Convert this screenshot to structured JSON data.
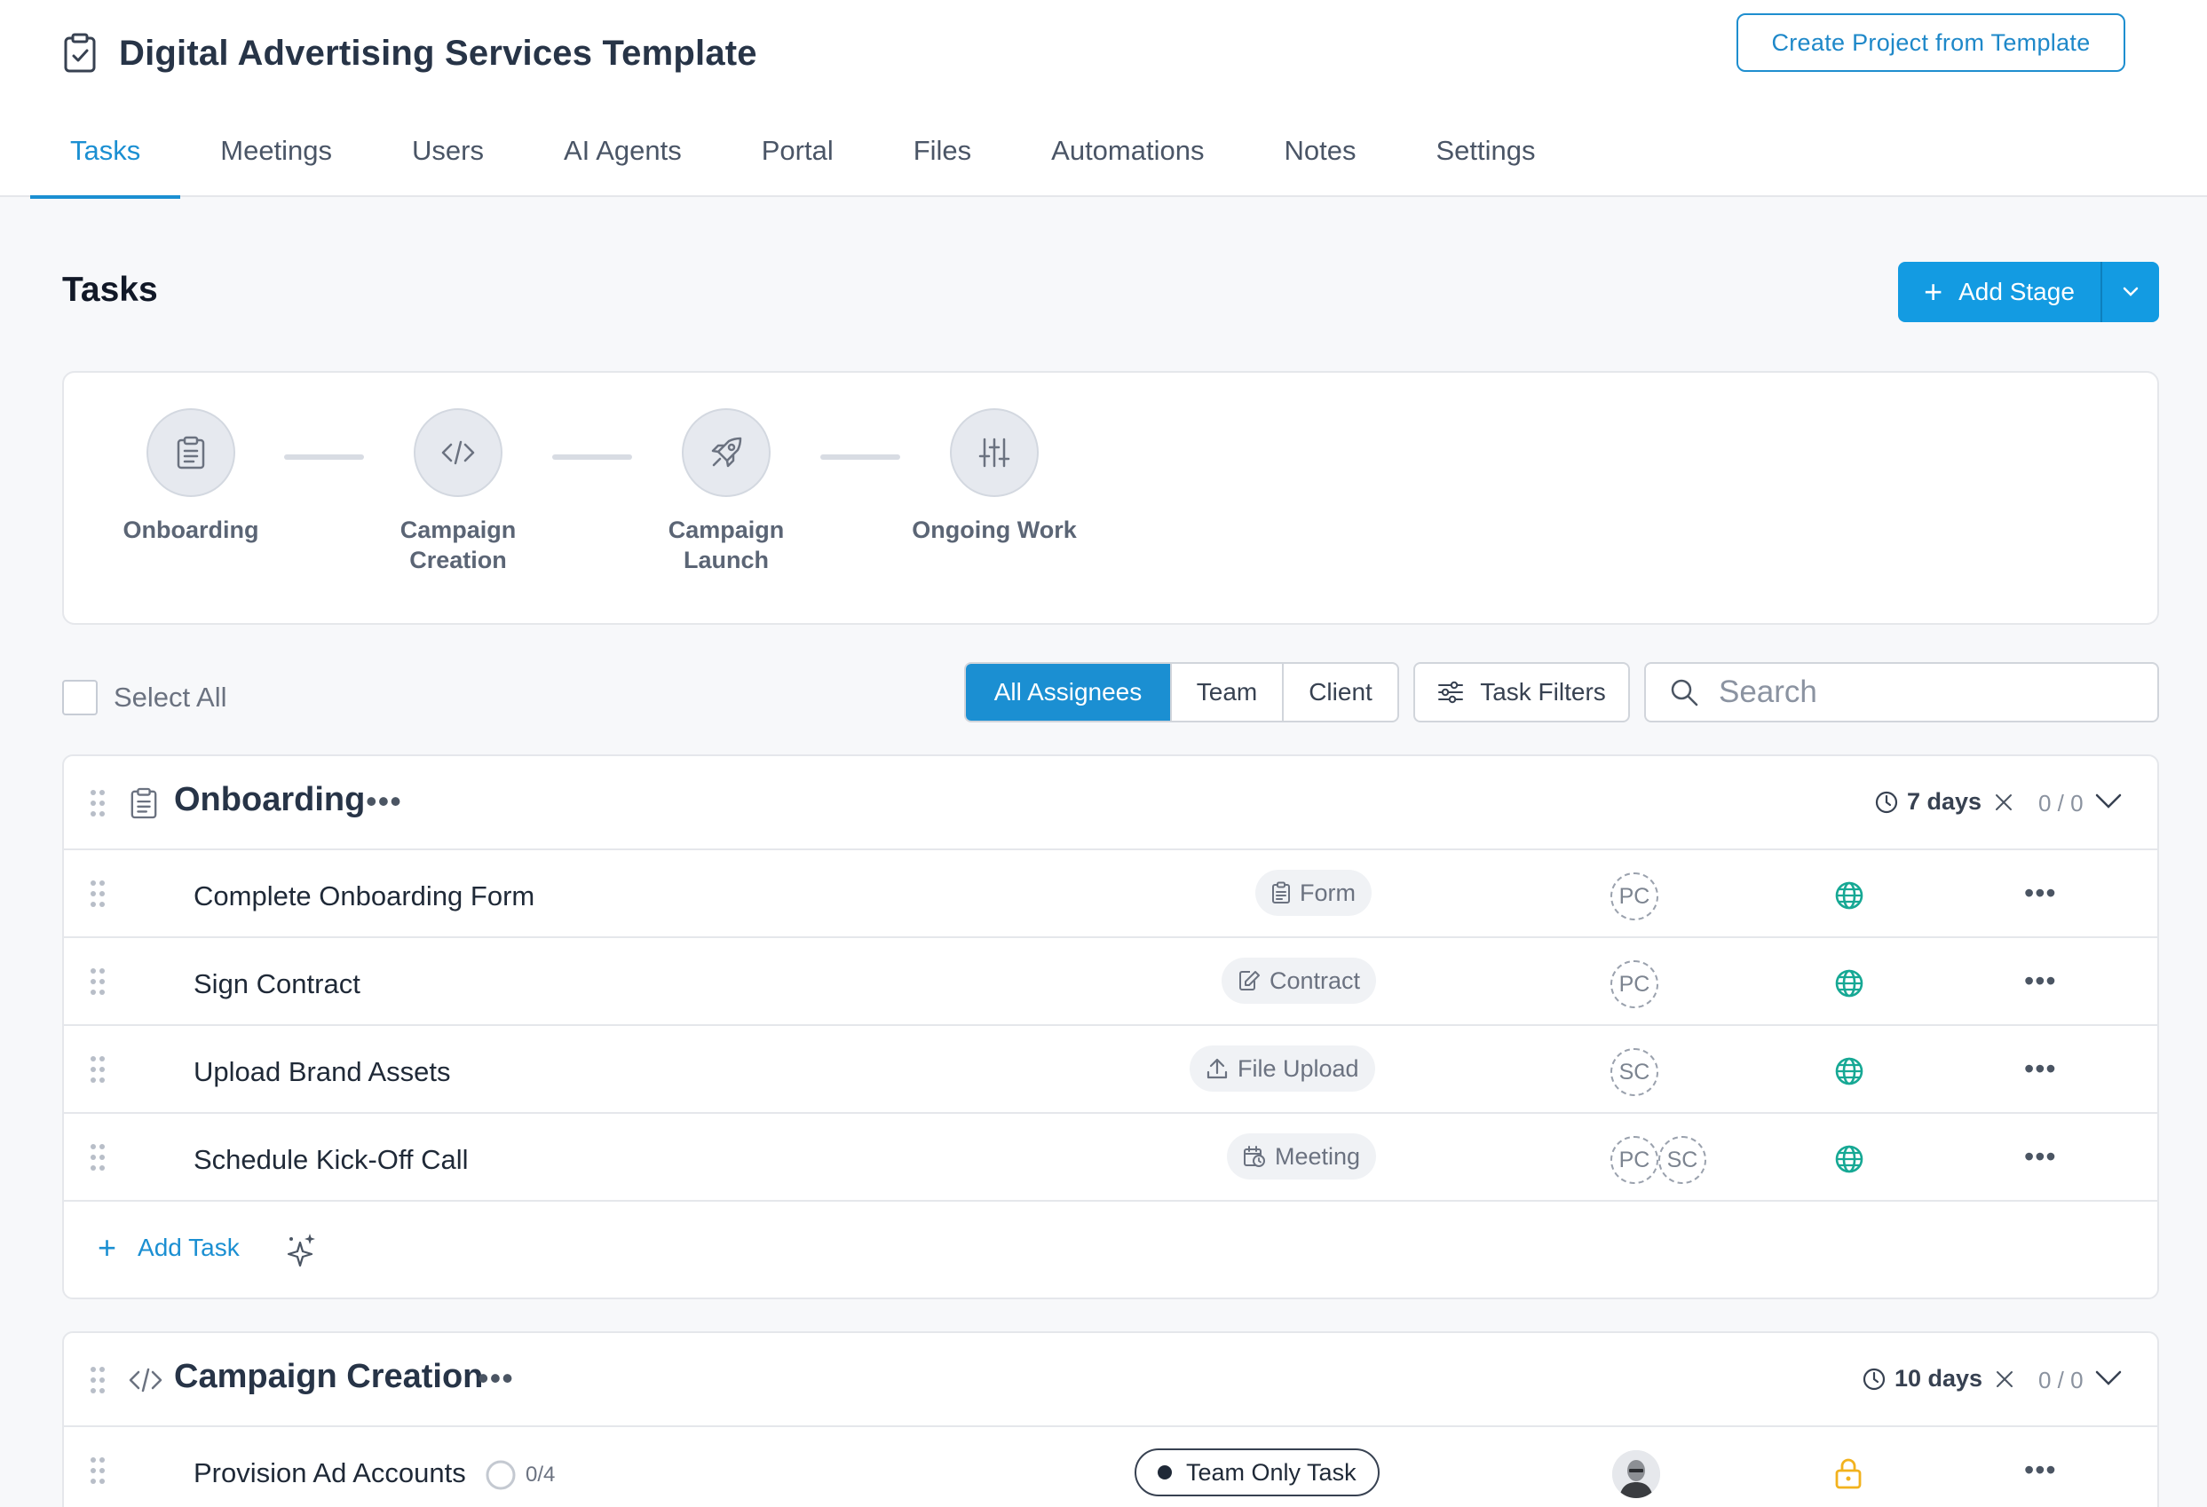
{
  "header": {
    "title": "Digital Advertising Services Template",
    "create_button": "Create Project from Template",
    "tabs": [
      {
        "label": "Tasks",
        "active": true
      },
      {
        "label": "Meetings"
      },
      {
        "label": "Users"
      },
      {
        "label": "AI Agents"
      },
      {
        "label": "Portal"
      },
      {
        "label": "Files"
      },
      {
        "label": "Automations"
      },
      {
        "label": "Notes"
      },
      {
        "label": "Settings"
      }
    ]
  },
  "section": {
    "title": "Tasks",
    "add_stage": "Add Stage"
  },
  "stages": [
    {
      "label": "Onboarding",
      "icon": "clipboard-icon"
    },
    {
      "label": "Campaign Creation",
      "icon": "code-icon"
    },
    {
      "label": "Campaign Launch",
      "icon": "rocket-icon"
    },
    {
      "label": "Ongoing Work",
      "icon": "sliders-icon"
    }
  ],
  "filters": {
    "select_all": "Select All",
    "assignees": [
      "All Assignees",
      "Team",
      "Client"
    ],
    "active_assignee": "All Assignees",
    "task_filters": "Task Filters",
    "search_placeholder": "Search"
  },
  "groups": [
    {
      "name": "Onboarding",
      "icon": "clipboard-icon",
      "duration": "7 days",
      "count": "0 / 0",
      "tasks": [
        {
          "name": "Complete Onboarding Form",
          "type": "Form",
          "type_icon": "form-icon",
          "assignees": [
            "PC"
          ],
          "visibility": "globe-icon"
        },
        {
          "name": "Sign Contract",
          "type": "Contract",
          "type_icon": "contract-icon",
          "assignees": [
            "PC"
          ],
          "visibility": "globe-icon"
        },
        {
          "name": "Upload Brand Assets",
          "type": "File Upload",
          "type_icon": "upload-icon",
          "assignees": [
            "SC"
          ],
          "visibility": "globe-icon"
        },
        {
          "name": "Schedule Kick-Off Call",
          "type": "Meeting",
          "type_icon": "calendar-icon",
          "assignees": [
            "PC",
            "SC"
          ],
          "visibility": "globe-icon"
        }
      ],
      "add_task": "Add Task"
    },
    {
      "name": "Campaign Creation",
      "icon": "code-icon",
      "duration": "10 days",
      "count": "0 / 0",
      "tasks": [
        {
          "name": "Provision Ad Accounts",
          "subtasks": "0/4",
          "tag": "Team Only Task",
          "assignee": "photo-avatar",
          "visibility": "lock-icon"
        }
      ]
    }
  ],
  "colors": {
    "accent": "#1b8fd2",
    "primary_button": "#139be2",
    "globe": "#16a894",
    "lock": "#f2b21d"
  }
}
